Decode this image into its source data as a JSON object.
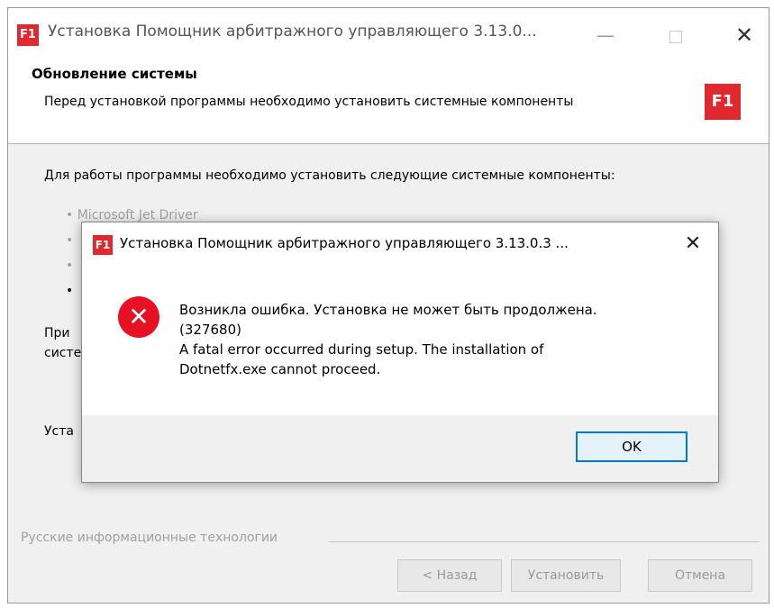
{
  "window": {
    "app_icon": "F1",
    "title": "Установка Помощник арбитражного управляющего 3.13.0...",
    "controls": {
      "minimize": "—",
      "close": "✕"
    }
  },
  "header": {
    "title": "Обновление системы",
    "subtitle": "Перед установкой программы необходимо установить системные компоненты",
    "logo": "F1"
  },
  "content": {
    "intro": "Для работы программы необходимо установить следующие системные компоненты:",
    "components": [
      "• Microsoft Jet Driver",
      "•",
      "•",
      "•"
    ],
    "note_line1": "При",
    "note_line2": "систе",
    "install_label": "Уста"
  },
  "footer": {
    "label": "Русские информационные технологии",
    "buttons": {
      "back": "< Назад",
      "install": "Установить",
      "cancel": "Отмена"
    }
  },
  "error_dialog": {
    "app_icon": "F1",
    "title": "Установка Помощник арбитражного управляющего 3.13.0.3 ...",
    "close": "✕",
    "icon": "error-x-icon",
    "icon_glyph": "✕",
    "message_line1": "Возникла ошибка. Установка не может быть продолжена.",
    "message_line2": "(327680)",
    "message_line3": "A fatal error occurred during setup. The installation of",
    "message_line4": "Dotnetfx.exe cannot proceed.",
    "ok_label": "OK"
  },
  "colors": {
    "brand_red": "#e0282e",
    "error_red": "#e81123",
    "focus_blue": "#0078d7"
  }
}
